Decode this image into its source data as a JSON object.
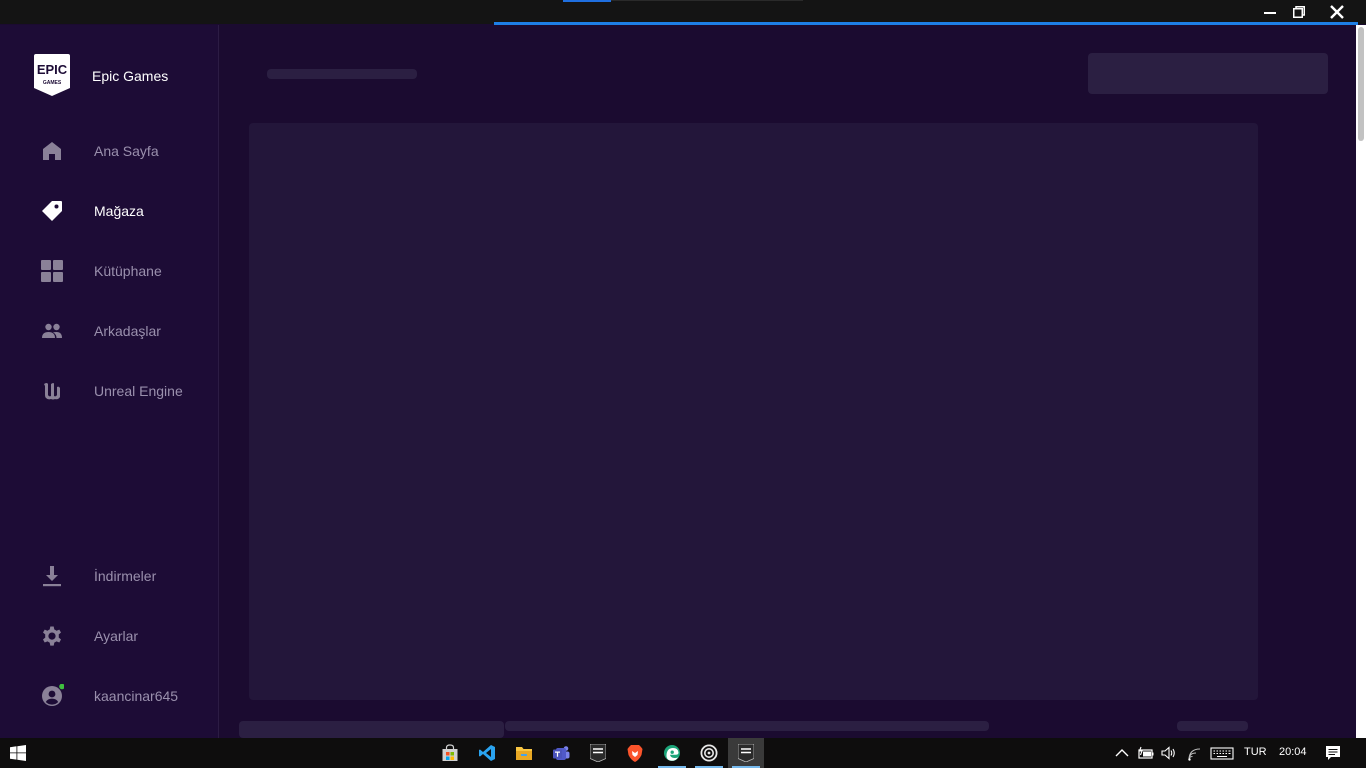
{
  "app": {
    "brand_name": "Epic Games",
    "logo_line1": "EPIC",
    "logo_line2": "GAMES"
  },
  "sidebar": {
    "items": [
      {
        "label": "Ana Sayfa",
        "icon": "home-icon"
      },
      {
        "label": "Mağaza",
        "icon": "tag-icon",
        "active": true
      },
      {
        "label": "Kütüphane",
        "icon": "grid-icon"
      },
      {
        "label": "Arkadaşlar",
        "icon": "friends-icon"
      },
      {
        "label": "Unreal Engine",
        "icon": "unreal-icon"
      }
    ],
    "bottom_items": [
      {
        "label": "İndirmeler",
        "icon": "download-icon"
      },
      {
        "label": "Ayarlar",
        "icon": "gear-icon"
      },
      {
        "label": "kaancinar645",
        "icon": "user-icon"
      }
    ]
  },
  "taskbar": {
    "apps": [
      "start-icon",
      "store-icon",
      "vscode-icon",
      "file-explorer-icon",
      "teams-icon",
      "epic-games-icon",
      "brave-icon",
      "edge-icon",
      "ubisoft-icon",
      "epic-games-active-icon"
    ],
    "language": "TUR",
    "time": "20:04"
  },
  "colors": {
    "accent_loading": "#1e7fe6",
    "online_status": "#3fbf3f",
    "sidebar_bg": "#1d0c36",
    "main_bg": "#1b0b30"
  }
}
